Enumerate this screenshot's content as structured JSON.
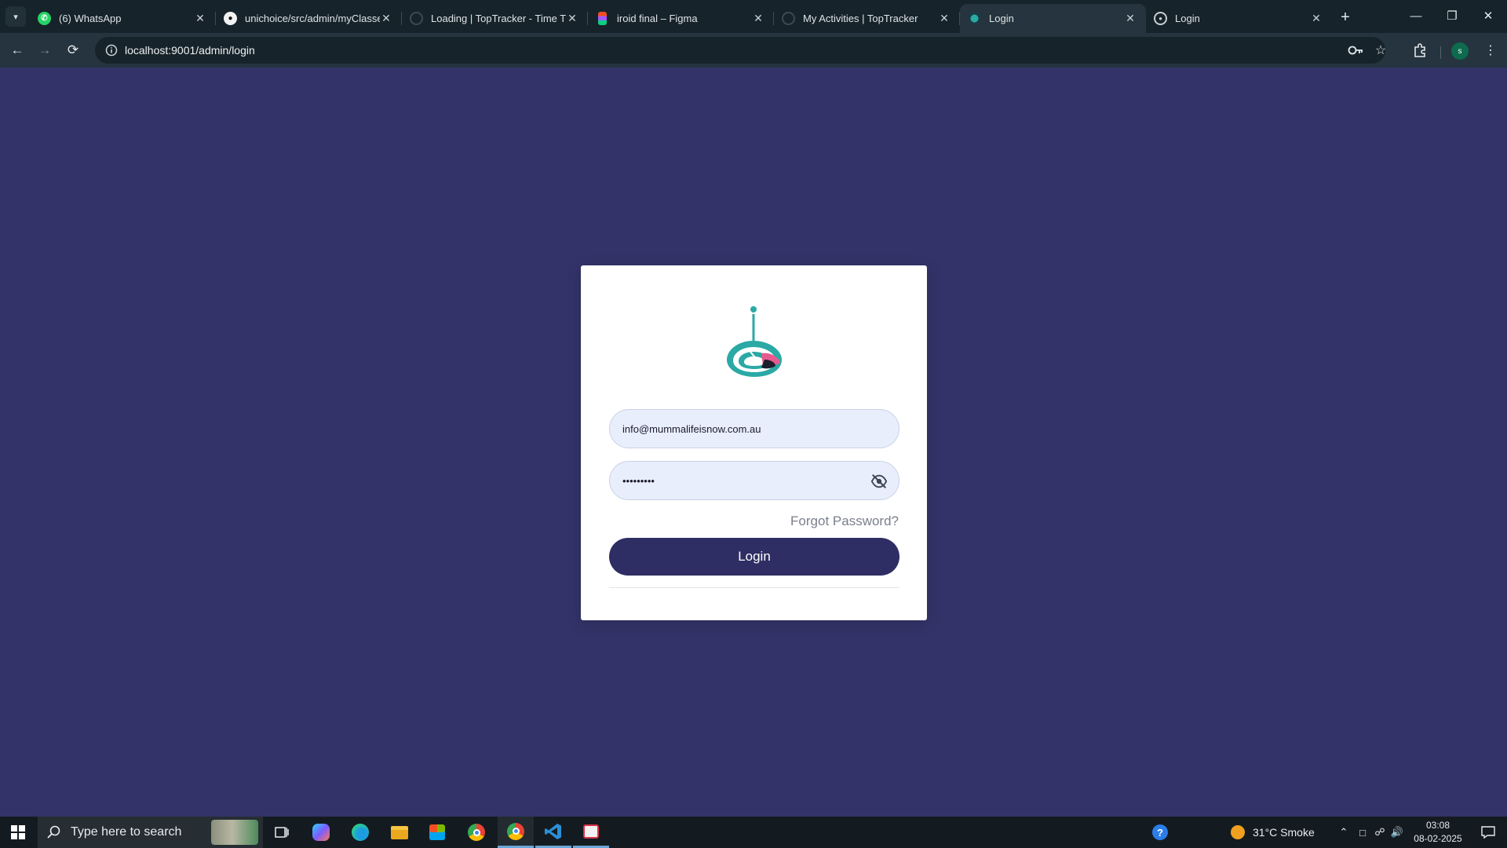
{
  "browser": {
    "tabs": [
      {
        "title": "(6) WhatsApp",
        "icon": "whatsapp-icon",
        "active": false
      },
      {
        "title": "unichoice/src/admin/myClasses",
        "icon": "github-icon",
        "active": false
      },
      {
        "title": "Loading | TopTracker - Time Tracker",
        "icon": "loading-icon",
        "active": false
      },
      {
        "title": "iroid final – Figma",
        "icon": "figma-icon",
        "active": false
      },
      {
        "title": "My Activities | TopTracker",
        "icon": "loading-icon",
        "active": false
      },
      {
        "title": "Login",
        "icon": "app-logo-icon",
        "active": true
      },
      {
        "title": "Login",
        "icon": "globe-icon",
        "active": false
      }
    ],
    "url": "localhost:9001/admin/login",
    "profile_initial": "s"
  },
  "login": {
    "email_value": "info@mummalifeisnow.com.au",
    "password_value": "•••••••••",
    "forgot_label": "Forgot Password?",
    "login_label": "Login"
  },
  "taskbar": {
    "search_placeholder": "Type here to search",
    "weather": "31°C  Smoke",
    "time": "03:08",
    "date": "08-02-2025"
  },
  "colors": {
    "page_background": "#33336a",
    "button": "#2e2e64",
    "input_background": "#e8eefc",
    "logo_teal": "#2aa9a5",
    "logo_pink": "#e85a8f"
  }
}
